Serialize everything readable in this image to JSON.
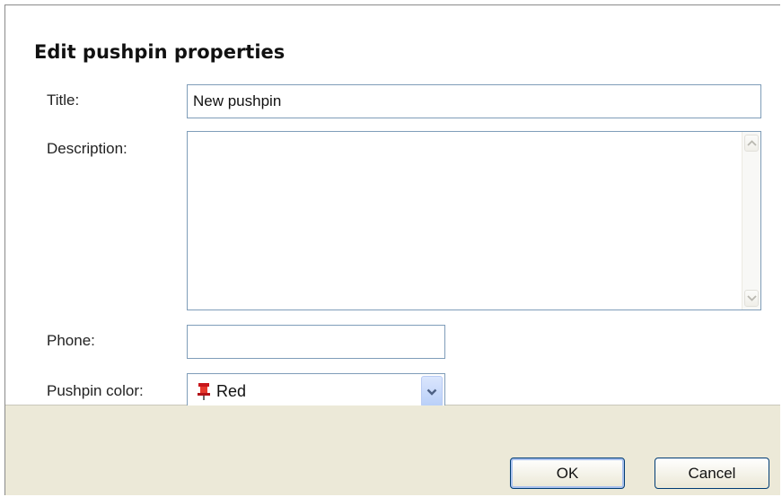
{
  "dialog": {
    "heading": "Edit pushpin properties"
  },
  "form": {
    "title_label": "Title:",
    "title_value": "New pushpin",
    "description_label": "Description:",
    "description_value": "",
    "phone_label": "Phone:",
    "phone_value": "",
    "color_label": "Pushpin color:",
    "color_value": "Red",
    "color_icon": "pushpin-icon",
    "color_icon_color": "#d9201a"
  },
  "buttons": {
    "ok_label": "OK",
    "cancel_label": "Cancel"
  },
  "colors": {
    "accent_border": "#7f9db9",
    "footer_bg": "#ece9d8",
    "button_border": "#003c74"
  }
}
